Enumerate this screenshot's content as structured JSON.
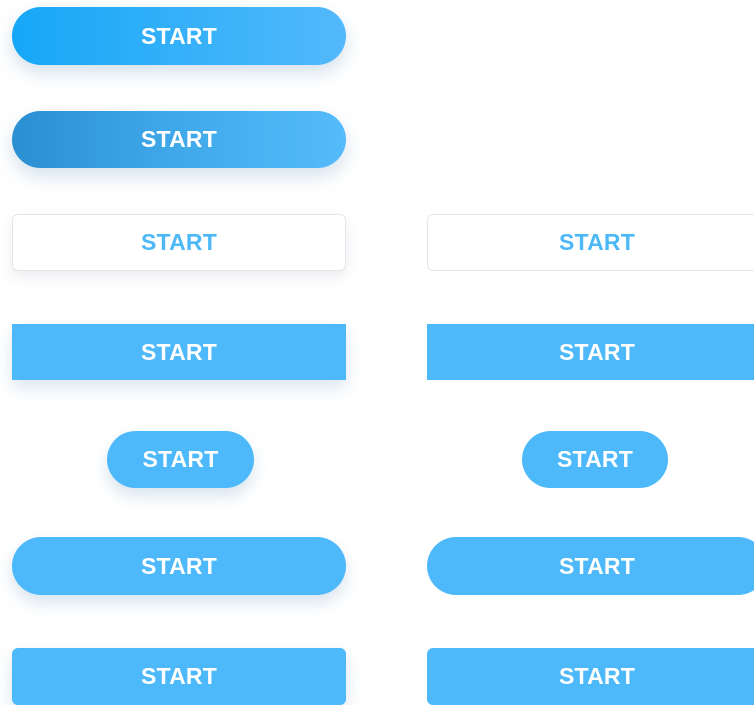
{
  "colors": {
    "primary": "#4eb9fa",
    "gradient_start": "#16a7f7",
    "gradient_dark_start": "#2b8fd1",
    "outline_border": "#e3e6ea",
    "outline_text": "#4db8f8",
    "label_on_fill": "#ffffff"
  },
  "buttons": {
    "gradient_pill": "START",
    "gradient_pill_pressed": "START",
    "outline_shadow": "START",
    "outline_flat": "START",
    "square_shadow": "START",
    "square_flat": "START",
    "small_pill_shadow": "START",
    "small_pill_flat": "START",
    "pill_shadow": "START",
    "pill_flat": "START",
    "rounded_shadow": "START",
    "rounded_flat": "START"
  }
}
